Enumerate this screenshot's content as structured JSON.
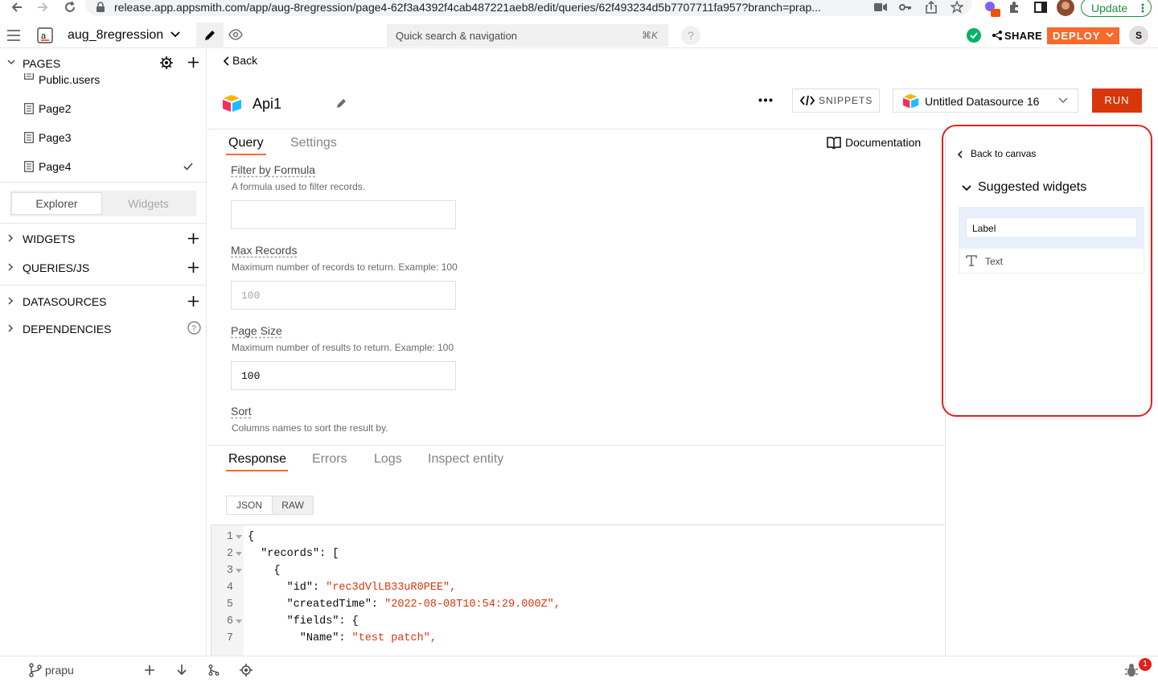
{
  "browser": {
    "url": "release.app.appsmith.com/app/aug-8regression/page4-62f3a4392f4cab487221aeb8/edit/queries/62f493234d5b7707711fa957?branch=prap...",
    "update_label": "Update"
  },
  "header": {
    "app_name": "aug_8regression",
    "search_placeholder": "Quick search & navigation",
    "search_shortcut": "⌘K",
    "help_label": "?",
    "share_label": "SHARE",
    "deploy_label": "DEPLOY",
    "avatar_initial": "S"
  },
  "sidebar": {
    "pages_title": "PAGES",
    "pages": [
      {
        "label": "Public.users"
      },
      {
        "label": "Page2"
      },
      {
        "label": "Page3"
      },
      {
        "label": "Page4",
        "selected": true
      }
    ],
    "toggle": {
      "explorer": "Explorer",
      "widgets": "Widgets"
    },
    "sections": [
      {
        "label": "WIDGETS"
      },
      {
        "label": "QUERIES/JS"
      },
      {
        "label": "DATASOURCES"
      },
      {
        "label": "DEPENDENCIES"
      }
    ]
  },
  "editor": {
    "back_label": "Back",
    "api_name": "Api1",
    "snippets_label": "SNIPPETS",
    "datasource_label": "Untitled Datasource 16",
    "run_label": "RUN",
    "tabs": [
      {
        "label": "Query",
        "active": true
      },
      {
        "label": "Settings",
        "active": false
      }
    ],
    "documentation_label": "Documentation",
    "fields": [
      {
        "label": "Filter by Formula",
        "help": "A formula used to filter records.",
        "value": "",
        "placeholder": ""
      },
      {
        "label": "Max Records",
        "help": "Maximum number of records to return. Example: 100",
        "value": "",
        "placeholder": "100"
      },
      {
        "label": "Page Size",
        "help": "Maximum number of results to return. Example: 100",
        "value": "100",
        "placeholder": ""
      },
      {
        "label": "Sort",
        "help": "Columns names to sort the result by."
      }
    ]
  },
  "response": {
    "tabs": [
      {
        "label": "Response",
        "active": true
      },
      {
        "label": "Errors",
        "active": false
      },
      {
        "label": "Logs",
        "active": false
      },
      {
        "label": "Inspect entity",
        "active": false
      }
    ],
    "format": {
      "json": "JSON",
      "raw": "RAW",
      "selected": "RAW"
    },
    "lines": [
      {
        "n": "1",
        "fold": true,
        "key": "{",
        "val": ""
      },
      {
        "n": "2",
        "fold": true,
        "key": "  \"records\": [",
        "val": ""
      },
      {
        "n": "3",
        "fold": true,
        "key": "    {",
        "val": ""
      },
      {
        "n": "4",
        "fold": false,
        "key": "      \"id\": ",
        "val": "\"rec3dVlLB33uR0PEE\","
      },
      {
        "n": "5",
        "fold": false,
        "key": "      \"createdTime\": ",
        "val": "\"2022-08-08T10:54:29.000Z\","
      },
      {
        "n": "6",
        "fold": true,
        "key": "      \"fields\": {",
        "val": ""
      },
      {
        "n": "7",
        "fold": false,
        "key": "        \"Name\": ",
        "val": "\"test patch\","
      }
    ]
  },
  "right_panel": {
    "back_label": "Back to canvas",
    "title": "Suggested widgets",
    "widgets": [
      {
        "label": "Label"
      },
      {
        "label": "Text"
      }
    ]
  },
  "bottom_bar": {
    "branch": "prapu",
    "badge_count": "1"
  },
  "colors": {
    "accent": "#f86a2b",
    "run": "#d8360b",
    "highlight": "#e0221b",
    "string": "#d8360b"
  }
}
